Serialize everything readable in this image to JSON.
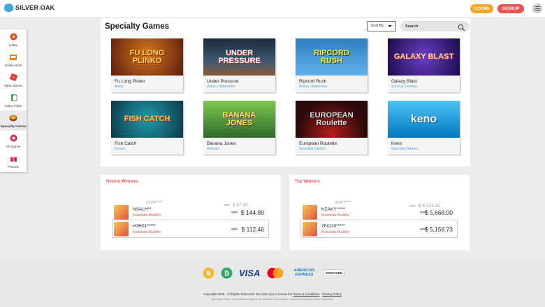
{
  "header": {
    "logo_name": "SILVER OAK",
    "logo_sub": "ONLINE CASINO",
    "login_label": "LOGIN",
    "signup_label": "SIGNUP",
    "menu_icon": "hamburger-icon"
  },
  "sidebar": {
    "items": [
      {
        "label": "Lobby",
        "icon": "chip-icon"
      },
      {
        "label": "Online Slots",
        "icon": "slot-machine-icon"
      },
      {
        "label": "Table Games",
        "icon": "dice-icon"
      },
      {
        "label": "Video Poker",
        "icon": "cards-icon"
      },
      {
        "label": "Specialty Games",
        "icon": "specialty-icon"
      },
      {
        "label": "All Games",
        "icon": "all-games-icon"
      },
      {
        "label": "Promos",
        "icon": "gift-icon"
      }
    ]
  },
  "main": {
    "title": "Specialty Games",
    "sort_label": "Sort By",
    "search_placeholder": "Search",
    "games": [
      {
        "name": "Fu Long Plinko",
        "category": "Asian",
        "art": "FU LONG PLINKO"
      },
      {
        "name": "Under Pressure",
        "category": "Action / Adventure",
        "art": "UNDER PRESSURE"
      },
      {
        "name": "Ripcord Rush",
        "category": "Action / Adventure",
        "art": "RIPCORD RUSH"
      },
      {
        "name": "Galaxy Blast",
        "category": "Sci-Fi & Fantasy",
        "art": "GALAXY BLAST"
      },
      {
        "name": "Fish Catch",
        "category": "Ocean",
        "art": "FISH CATCH"
      },
      {
        "name": "Banana Jones",
        "category": "Animals",
        "art": "BANANA JONES"
      },
      {
        "name": "European Roulette",
        "category": "Specialty Games",
        "art": "EUROPEAN Roulette"
      },
      {
        "name": "Keno",
        "category": "Specialty Games",
        "art": "keno"
      }
    ]
  },
  "recent_winners": {
    "title": "Recent Winners",
    "ghost_user": "GLVW*****",
    "ghost_amount": "$ 87.30",
    "won_label": "won",
    "rows": [
      {
        "user": "NSALH**",
        "game": "Fortunate Buddha",
        "amount": "$ 144.89"
      },
      {
        "user": "H3R01*****",
        "game": "Fortunate Buddha",
        "amount": "$ 112.46"
      }
    ]
  },
  "top_winners": {
    "title": "Top Winners",
    "ghost_user": "JESI*******",
    "ghost_game": "Fortunate Buddha",
    "ghost_amount": "$ 6,141.42",
    "won_label": "won",
    "rows": [
      {
        "user": "HZAKY*****",
        "game": "Fortunate Buddha",
        "amount": "$ 5,668.00"
      },
      {
        "user": "7FCG9*****",
        "game": "Fortunate Buddha",
        "amount": "$ 5,158.73"
      }
    ]
  },
  "footer": {
    "payments": [
      "B",
      "₿",
      "VISA",
      "mastercard",
      "AMERICAN EXPRESS",
      "DISCOVER"
    ],
    "copyright": "Copyright 2026 - All Rights Reserved. We invite you to review the",
    "terms_link": "Terms & Conditions",
    "privacy_link": "Privacy Policy",
    "disclaimer": "Standard Terms & Conditions apply to all available promotions, unless specifically stated otherwise."
  }
}
